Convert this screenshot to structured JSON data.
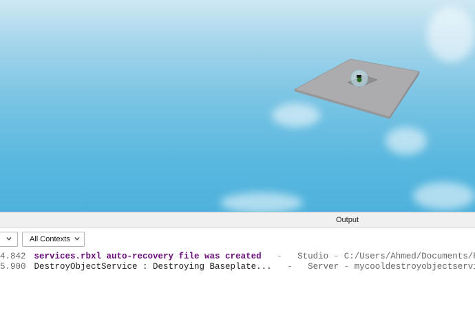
{
  "output_panel": {
    "title": "Output",
    "filter_dropdown_value": "All Contexts",
    "log": [
      {
        "timestamp": "4.842",
        "message": "services.rbxl auto-recovery file was created",
        "separator1": "-",
        "context": "Studio",
        "separator2": "-",
        "source": "C:/Users/Ahmed/Documents/ROBLO"
      },
      {
        "timestamp": "5.900",
        "message": "DestroyObjectService : Destroying Baseplate...",
        "separator1": "-",
        "context": "Server",
        "separator2": "-",
        "source": "mycooldestroyobjectservice:"
      }
    ]
  },
  "colors": {
    "sky_top": "#cfe8f3",
    "sky_bottom": "#4fb2dc",
    "baseplate": "#a9a9ab",
    "warning_text": "#6a0d7a"
  }
}
